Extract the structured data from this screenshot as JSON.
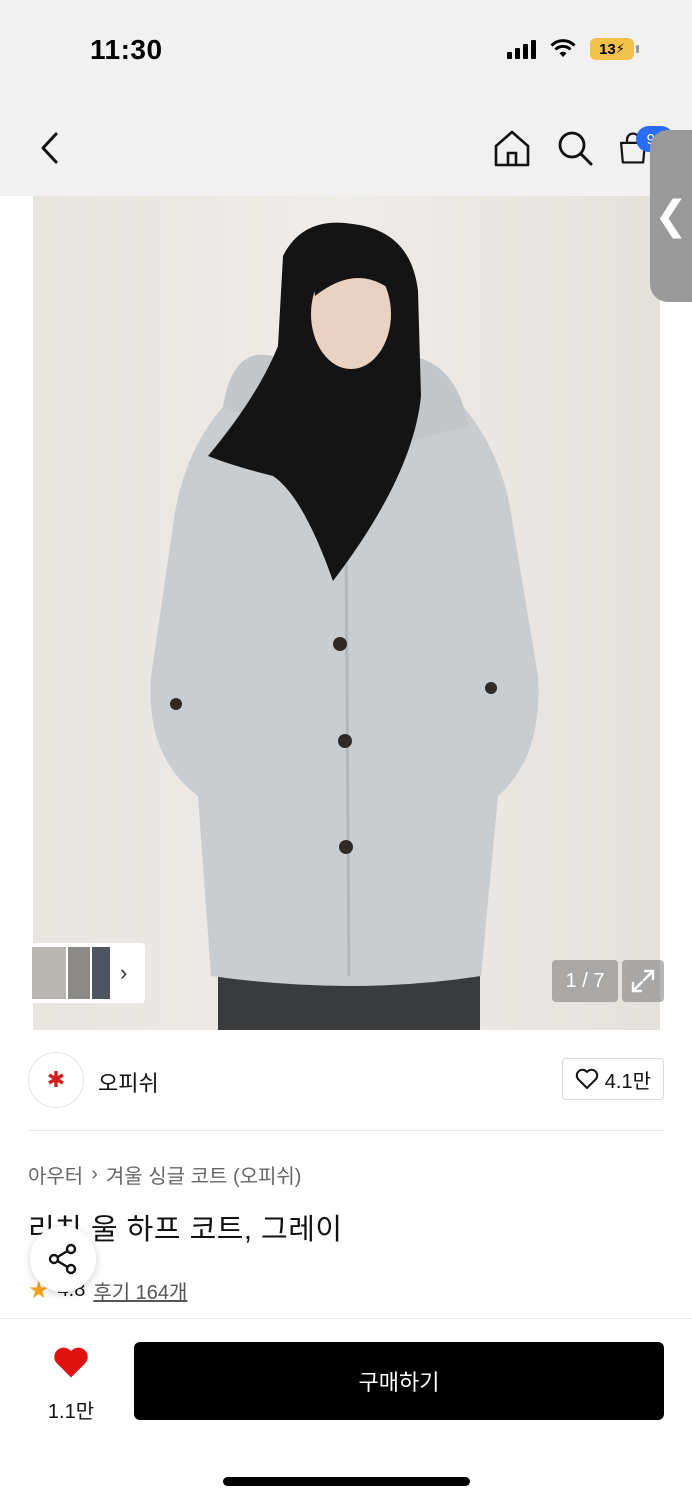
{
  "status": {
    "time": "11:30",
    "battery": "13"
  },
  "nav": {
    "back_icon": "chevron-left-icon",
    "home_icon": "home-icon",
    "search_icon": "search-icon",
    "cart_icon": "shopping-bag-icon",
    "cart_badge": "99"
  },
  "gallery": {
    "pager": "1 / 7",
    "expand_icon": "expand-icon",
    "thumb_more": "›"
  },
  "brand": {
    "name": "오피쉬",
    "likes": "4.1만"
  },
  "product": {
    "breadcrumb": [
      "아우터",
      "겨울 싱글 코트 (오피쉬)"
    ],
    "title": "리치 울 하프 코트, 그레이",
    "rating": "4.8",
    "reviews": "후기 164개"
  },
  "bottom": {
    "wish_count": "1.1만",
    "buy_label": "구매하기"
  },
  "colors": {
    "accent_blue": "#2a6cf6",
    "wish_red": "#e11111",
    "star": "#f4a21a"
  }
}
